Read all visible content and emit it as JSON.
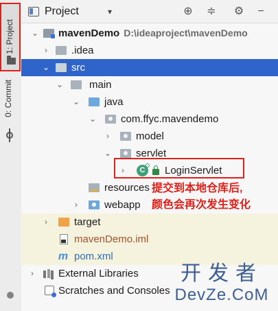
{
  "left_stripe": {
    "project_tab": "1: Project",
    "commit_tab": "0: Commit"
  },
  "header": {
    "title": "Project",
    "dropdown_glyph": "▾",
    "icons": [
      "crosshair-icon",
      "collapse-all-icon",
      "gear-icon",
      "minimize-icon"
    ]
  },
  "tree": {
    "root": {
      "name": "mavenDemo",
      "path": "D:\\ideaproject\\mavenDemo"
    },
    "idea": ".idea",
    "src": "src",
    "main": "main",
    "java": "java",
    "package": "com.ffyc.mavendemo",
    "model": "model",
    "servlet": "servlet",
    "login_servlet": "LoginServlet",
    "resources": "resources",
    "webapp": "webapp",
    "target": "target",
    "iml": "mavenDemo.iml",
    "pom": "pom.xml",
    "external_libraries": "External Libraries",
    "scratches": "Scratches and Consoles"
  },
  "annotation": {
    "line1": "提交到本地仓库后,",
    "line2": "颜色会再次发生变化"
  },
  "watermark": {
    "cn": "开发者",
    "en": "DevZe.CoM"
  },
  "colors": {
    "selection": "#2f65ca",
    "annotation_red": "#e0201a",
    "iml_text": "#a0522d",
    "pom_text": "#2f6fb5",
    "target_folder": "#f0a24b",
    "servlet_text": "#1a1a1a"
  }
}
